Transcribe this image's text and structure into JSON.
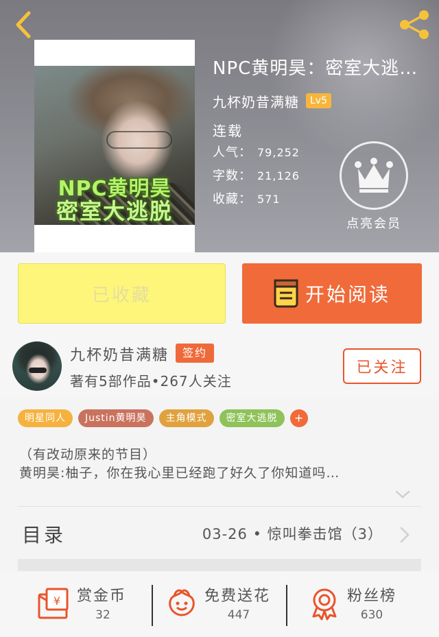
{
  "header": {
    "title": "NPC黄明昊：密室大逃…",
    "author": "九杯奶昔满糖",
    "level": "Lv5",
    "status": "连载",
    "stats": [
      {
        "label": "人气：",
        "value": "79,252"
      },
      {
        "label": "字数：",
        "value": "21,126"
      },
      {
        "label": "收藏：",
        "value": "571"
      }
    ],
    "cover_text_line1": "NPC黄明昊",
    "cover_text_line2": "密室大逃脱",
    "vip_label": "点亮会员"
  },
  "actions": {
    "favorite_label": "已收藏",
    "read_label": "开始阅读"
  },
  "author_row": {
    "name": "九杯奶昔满糖",
    "badge": "签约",
    "meta": "著有5部作品•267人关注",
    "follow_label": "已关注"
  },
  "tags": [
    {
      "label": "明星同人",
      "color": "#f6b23f"
    },
    {
      "label": "Justin黄明昊",
      "color": "#c9735f"
    },
    {
      "label": "主角模式",
      "color": "#e0a23e"
    },
    {
      "label": "密室大逃脱",
      "color": "#8fc25a"
    }
  ],
  "tag_add_label": "+",
  "description": {
    "line1": "（有改动原来的节目）",
    "line2": "黄明昊:柚子，你在我心里已经跑了好久了你知道吗…"
  },
  "catalog": {
    "label": "目录",
    "latest": "03-26 • 惊叫拳击馆（3）"
  },
  "bottom": [
    {
      "label": "赏金币",
      "value": "32"
    },
    {
      "label": "免费送花",
      "value": "447"
    },
    {
      "label": "粉丝榜",
      "value": "630"
    }
  ],
  "colors": {
    "accent": "#f06a3a",
    "favorite_bg": "#fdf67a",
    "icon_red": "#e9542a",
    "header_yellow": "#f6c23a"
  }
}
